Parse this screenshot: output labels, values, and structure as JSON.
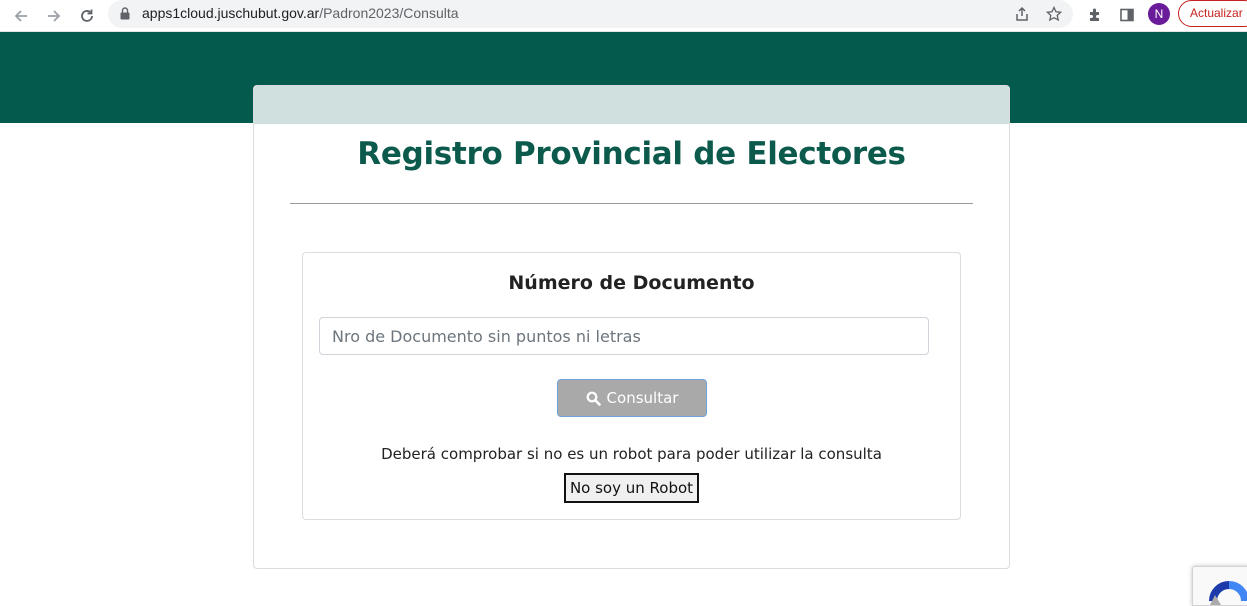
{
  "browser": {
    "url_host": "apps1cloud.juschubut.gov.ar",
    "url_path": "/Padron2023/Consulta",
    "profile_initial": "N",
    "update_label": "Actualizar"
  },
  "header": {
    "title": "Registro Provincial de Electores"
  },
  "form": {
    "section_title": "Número de Documento",
    "document_placeholder": "Nro de Documento sin puntos ni letras",
    "document_value": "",
    "consult_label": "Consultar",
    "robot_notice": "Deberá comprobar si no es un robot para poder utilizar la consulta",
    "robot_button_label": "No soy un Robot"
  },
  "colors": {
    "band": "#035a4d",
    "card_header": "#cfe0df",
    "title": "#0b5a4c",
    "button_disabled": "#a9a9a9"
  },
  "icons": [
    "back-arrow-icon",
    "forward-arrow-icon",
    "reload-icon",
    "lock-icon",
    "share-icon",
    "star-icon",
    "extensions-icon",
    "side-panel-icon",
    "search-icon",
    "recaptcha-icon"
  ]
}
